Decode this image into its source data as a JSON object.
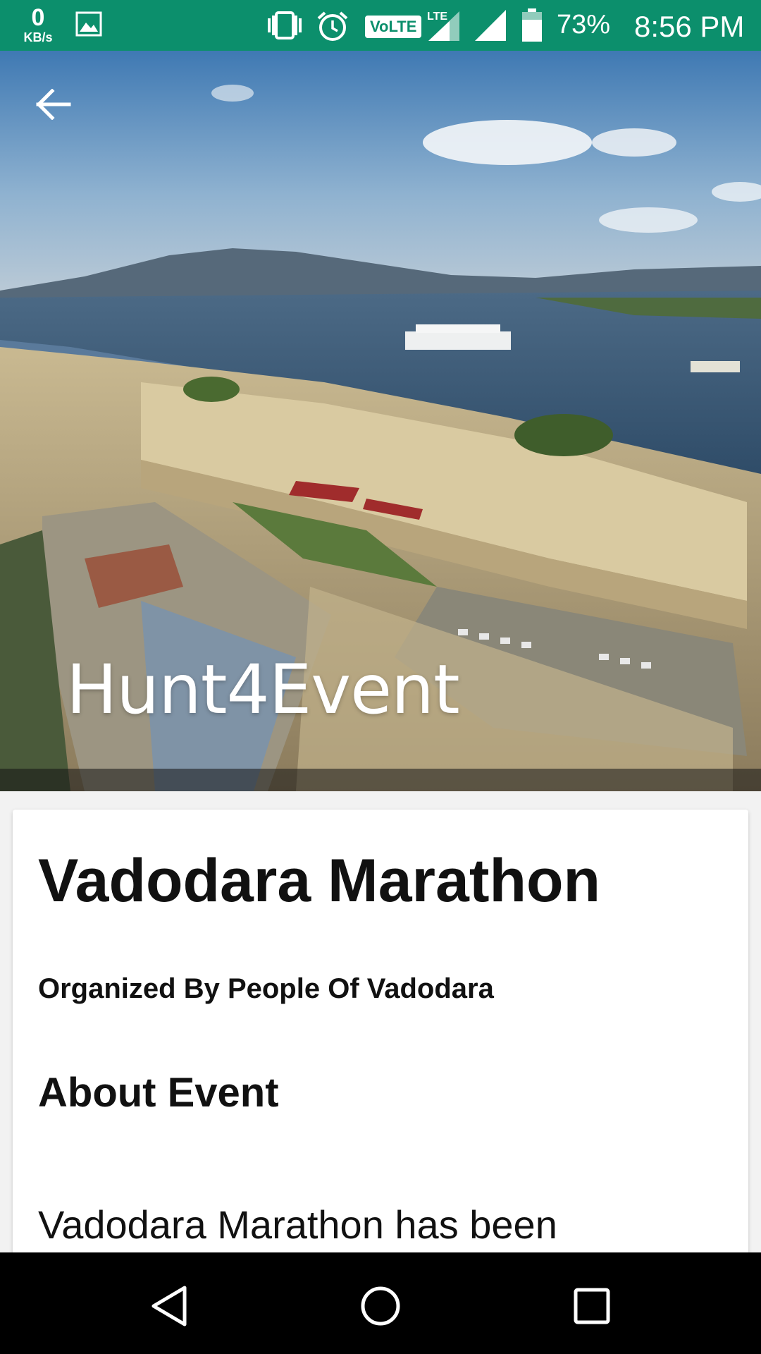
{
  "status_bar": {
    "net_speed_value": "0",
    "net_speed_unit": "KB/s",
    "lte_label": "VoLTE",
    "battery": "73%",
    "time": "8:56 PM",
    "color": "#0c8f6c"
  },
  "hero": {
    "app_title": "Hunt4Event"
  },
  "event": {
    "title": "Vadodara Marathon",
    "organizer": "Organized By People Of Vadodara",
    "about_heading": "About Event",
    "about_text": "Vadodara Marathon has been"
  },
  "icons": {
    "back": "arrow-left-icon",
    "nav_back": "triangle-back-icon",
    "nav_home": "circle-home-icon",
    "nav_recents": "square-recents-icon"
  }
}
